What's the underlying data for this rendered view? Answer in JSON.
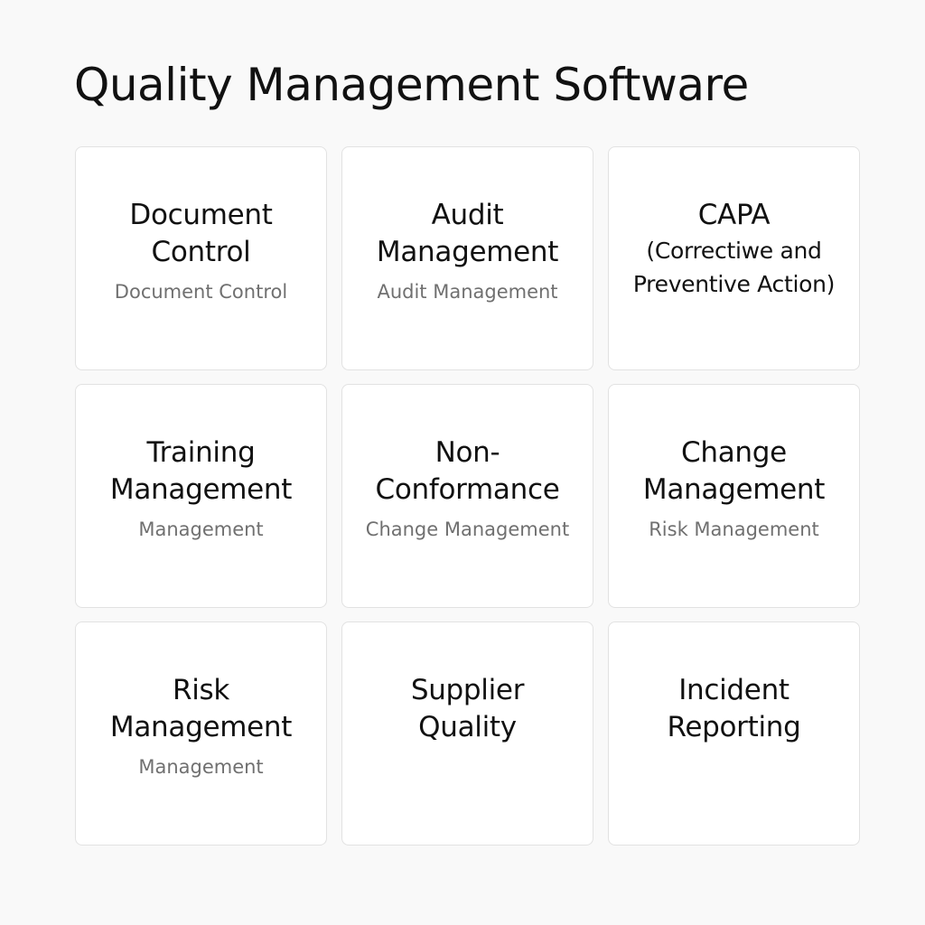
{
  "page": {
    "title": "Quality Management Software"
  },
  "modules": [
    {
      "title_lines": [
        "Document",
        "Control"
      ],
      "subtitle": "Document Control"
    },
    {
      "title_lines": [
        "Audit",
        "Management"
      ],
      "subtitle": "Audit Management"
    },
    {
      "title_lines": [
        "CAPA",
        "(Correctiwe and",
        "Preventive Action)"
      ],
      "subtitle": ""
    },
    {
      "title_lines": [
        "Training",
        "Management"
      ],
      "subtitle": "Management"
    },
    {
      "title_lines": [
        "Non-",
        "Conformance"
      ],
      "subtitle": "Change Management"
    },
    {
      "title_lines": [
        "Change",
        "Management"
      ],
      "subtitle": "Risk Management"
    },
    {
      "title_lines": [
        "Risk",
        "Management"
      ],
      "subtitle": "Management"
    },
    {
      "title_lines": [
        "Supplier",
        "Quality"
      ],
      "subtitle": ""
    },
    {
      "title_lines": [
        "Incident",
        "Reporting"
      ],
      "subtitle": ""
    }
  ]
}
